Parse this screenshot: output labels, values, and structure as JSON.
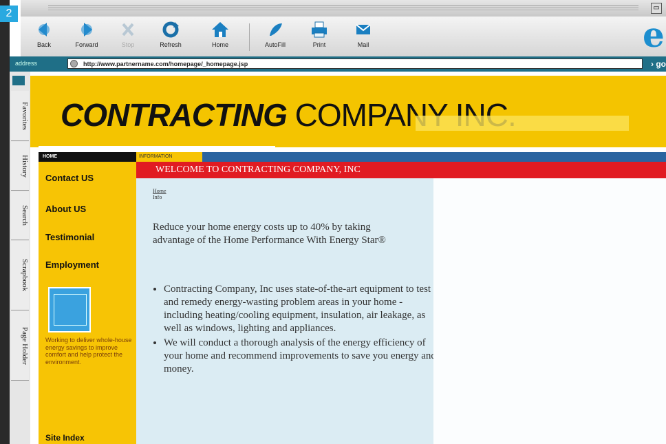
{
  "badge": "2",
  "toolbar": {
    "buttons": [
      {
        "label": "Back",
        "icon": "back-arrow-icon"
      },
      {
        "label": "Forward",
        "icon": "forward-arrow-icon"
      },
      {
        "label": "Stop",
        "icon": "stop-icon"
      },
      {
        "label": "Refresh",
        "icon": "refresh-icon"
      },
      {
        "label": "Home",
        "icon": "home-icon"
      },
      {
        "label": "AutoFill",
        "icon": "autofill-icon"
      },
      {
        "label": "Print",
        "icon": "print-icon"
      },
      {
        "label": "Mail",
        "icon": "mail-icon"
      }
    ]
  },
  "address": {
    "label": "address",
    "url": "http://www.partnername.com/homepage/_homepage.jsp",
    "go": "go"
  },
  "explorer_tabs": [
    "Favorites",
    "History",
    "Search",
    "Scrapbook",
    "Page Holder"
  ],
  "site": {
    "logo_bold": "CONTRACTING",
    "logo_rest": " COMPANY INC.",
    "sidebar_header": "HOME",
    "nav": [
      "Contact US",
      "About US",
      "Testimonial",
      "Employment"
    ],
    "blurb": "Working to deliver whole-house energy savings to improve comfort and help protect the environment.",
    "site_index": "Site Index",
    "info_tab": "INFORMATION",
    "welcome": "WELCOME TO CONTRACTING COMPANY, INC",
    "crumb_top": "Home",
    "crumb_bottom": "Info",
    "intro": "Reduce your home energy costs up to 40% by taking advantage of the Home Performance With Energy Star®",
    "bullets": [
      "Contracting Company, Inc uses state-of-the-art equipment to test and remedy energy-wasting problem areas in your home - including heating/cooling equipment, insulation, air leakage, as well as windows, lighting and appliances.",
      "We will conduct a thorough analysis of the energy efficiency of your home and recommend improvements to save you energy and money."
    ]
  },
  "colors": {
    "banner": "#f4c400",
    "welcome_bar": "#e11b22",
    "main_bg": "#dbecf3",
    "address_bar": "#1f6f87"
  }
}
